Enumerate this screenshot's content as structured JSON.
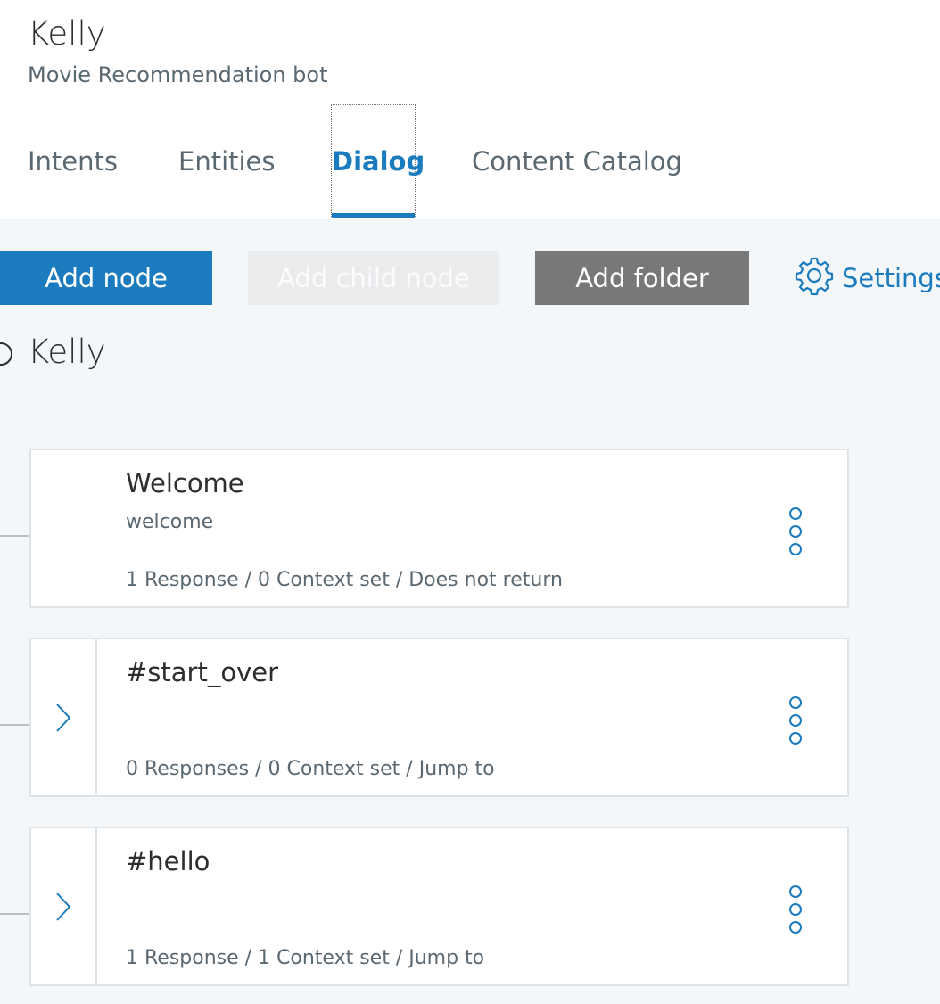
{
  "header": {
    "workspace_name": "Kelly",
    "workspace_description": "Movie Recommendation bot"
  },
  "tabs": [
    {
      "label": "Intents",
      "active": false
    },
    {
      "label": "Entities",
      "active": false
    },
    {
      "label": "Dialog",
      "active": true
    },
    {
      "label": "Content Catalog",
      "active": false
    }
  ],
  "toolbar": {
    "add_node_label": "Add node",
    "add_child_node_label": "Add child node",
    "add_folder_label": "Add folder",
    "settings_label": "Settings",
    "settings_icon": "gear-icon"
  },
  "tree": {
    "root_label": "Kelly",
    "nodes": [
      {
        "title": "Welcome",
        "condition": "welcome",
        "summary": "1 Response / 0 Context set / Does not return",
        "has_children": false
      },
      {
        "title": "#start_over",
        "condition": "",
        "summary": "0 Responses / 0 Context set / Jump to",
        "has_children": true
      },
      {
        "title": "#hello",
        "condition": "",
        "summary": "1 Response / 1 Context set / Jump to",
        "has_children": true
      }
    ]
  },
  "colors": {
    "accent": "#1a7bbf",
    "folder_button": "#787878",
    "disabled_button": "#e9ebed",
    "canvas": "#f4f7fa"
  }
}
